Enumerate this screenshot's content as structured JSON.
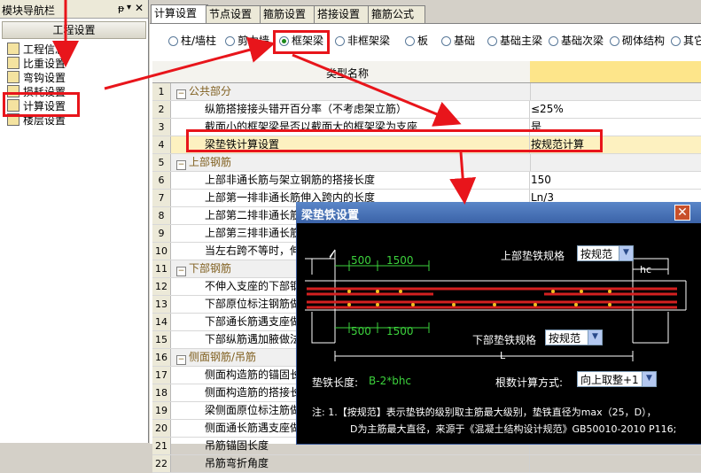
{
  "nav": {
    "title": "模块导航栏",
    "pin": "ᵽ",
    "dropdown": "▾",
    "close": "✕",
    "section": "工程设置",
    "items": [
      {
        "label": "工程信息",
        "icon": "project-info-icon"
      },
      {
        "label": "比重设置",
        "icon": "weight-icon"
      },
      {
        "label": "弯钩设置",
        "icon": "hook-icon"
      },
      {
        "label": "损耗设置",
        "icon": "loss-icon"
      },
      {
        "label": "计算设置",
        "icon": "calc-settings-icon"
      },
      {
        "label": "楼层设置",
        "icon": "floor-icon"
      }
    ]
  },
  "tabs": [
    "计算设置",
    "节点设置",
    "箍筋设置",
    "搭接设置",
    "箍筋公式"
  ],
  "radios": [
    "柱/墙柱",
    "剪力墙",
    "框架梁",
    "非框架梁",
    "板",
    "基础",
    "基础主梁",
    "基础次梁",
    "砌体结构",
    "其它"
  ],
  "selected_radio": "框架梁",
  "grid": {
    "header": "类型名称",
    "rows": [
      {
        "n": "1",
        "name": "公共部分",
        "value": "",
        "cat": true
      },
      {
        "n": "2",
        "name": "纵筋搭接接头错开百分率（不考虑架立筋）",
        "value": "≤25%"
      },
      {
        "n": "3",
        "name": "截面小的框架梁是否以截面大的框架梁为支座",
        "value": "是"
      },
      {
        "n": "4",
        "name": "梁垫铁计算设置",
        "value": "按规范计算"
      },
      {
        "n": "5",
        "name": "上部钢筋",
        "value": "",
        "cat": true
      },
      {
        "n": "6",
        "name": "上部非通长筋与架立钢筋的搭接长度",
        "value": "150"
      },
      {
        "n": "7",
        "name": "上部第一排非通长筋伸入跨内的长度",
        "value": "Ln/3"
      },
      {
        "n": "8",
        "name": "上部第二排非通长筋",
        "value": ""
      },
      {
        "n": "9",
        "name": "上部第三排非通长筋",
        "value": ""
      },
      {
        "n": "10",
        "name": "当左右跨不等时，伸",
        "value": ""
      },
      {
        "n": "11",
        "name": "下部钢筋",
        "value": "",
        "cat": true
      },
      {
        "n": "12",
        "name": "不伸入支座的下部钢",
        "value": ""
      },
      {
        "n": "13",
        "name": "下部原位标注钢筋做",
        "value": ""
      },
      {
        "n": "14",
        "name": "下部通长筋遇支座做",
        "value": ""
      },
      {
        "n": "15",
        "name": "下部纵筋遇加腋做法",
        "value": ""
      },
      {
        "n": "16",
        "name": "侧面钢筋/吊筋",
        "value": "",
        "cat": true
      },
      {
        "n": "17",
        "name": "侧面构造筋的锚固长",
        "value": ""
      },
      {
        "n": "18",
        "name": "侧面构造筋的搭接长",
        "value": ""
      },
      {
        "n": "19",
        "name": "梁侧面原位标注筋做",
        "value": ""
      },
      {
        "n": "20",
        "name": "侧面通长筋遇支座做",
        "value": ""
      },
      {
        "n": "21",
        "name": "吊筋锚固长度",
        "value": ""
      },
      {
        "n": "22",
        "name": "吊筋弯折角度",
        "value": ""
      }
    ]
  },
  "dialog": {
    "title": "梁垫铁设置",
    "close": "✕",
    "top_label": "上部垫铁规格",
    "top_value": "按规范",
    "bottom_label": "下部垫铁规格",
    "bottom_value": "按规范",
    "dim_500_top": "500",
    "dim_1500_top": "1500",
    "dim_500_bottom": "500",
    "dim_1500_bottom": "1500",
    "dim_hc": "hc",
    "dim_L": "L",
    "length_label": "垫铁长度:",
    "length_formula": "B-2*bhc",
    "count_label": "根数计算方式:",
    "count_value": "向上取整+1",
    "note_line1": "注: 1.【按规范】表示垫铁的级别取主筋最大级别，垫铁直径为max（25，D），",
    "note_line2": "D为主筋最大直径，来源于《混凝土结构设计规范》GB50010-2010 P116;"
  },
  "colors": {
    "accent_red": "#e8151b",
    "header_yellow": "#fde58a",
    "rebar_red": "#d42020",
    "dim_green": "#3cd23c"
  }
}
